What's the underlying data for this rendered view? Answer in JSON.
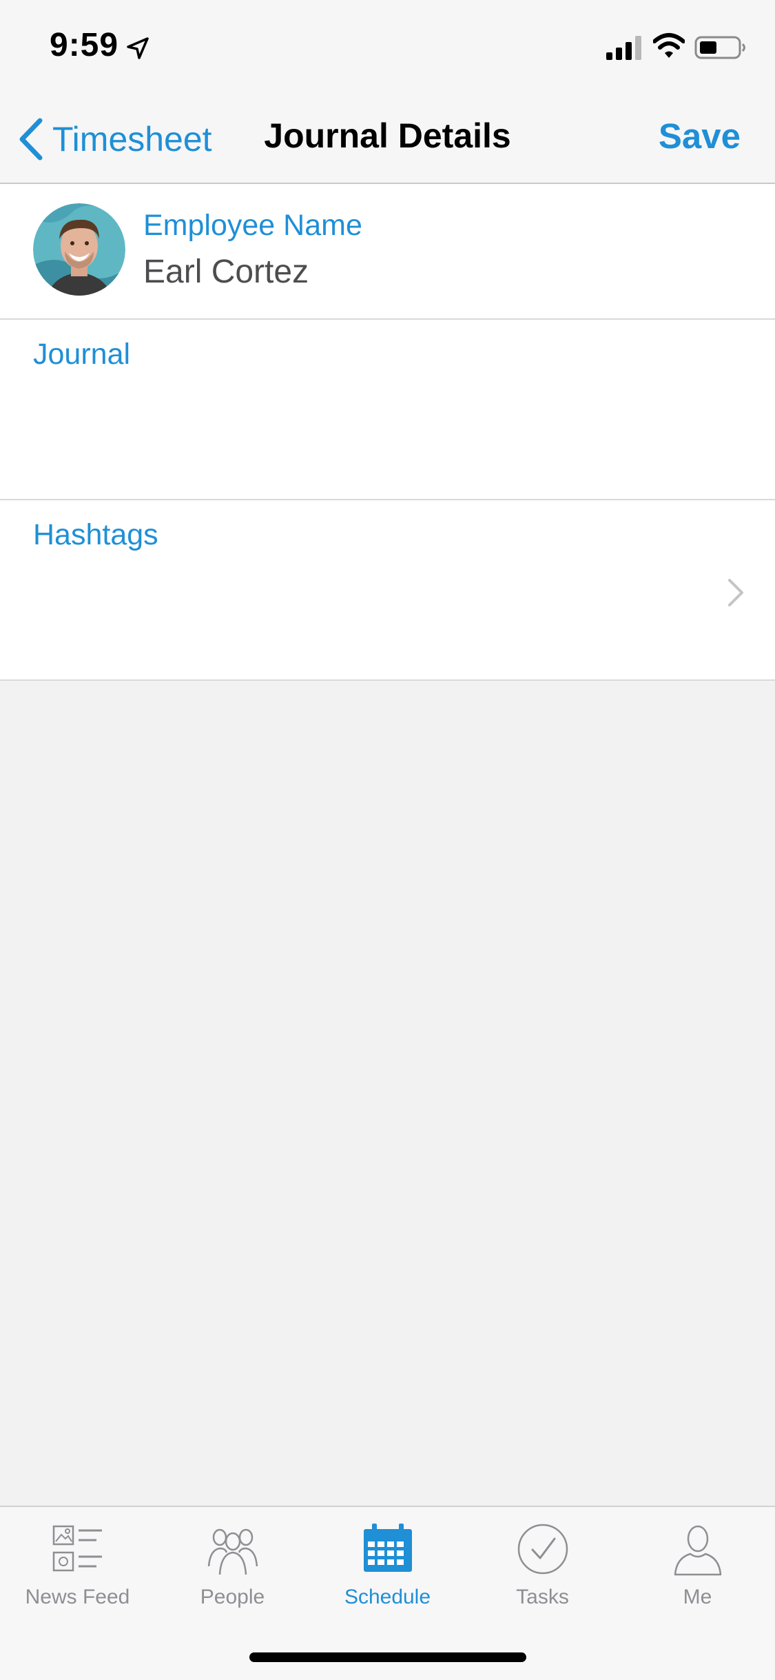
{
  "status_bar": {
    "time": "9:59"
  },
  "nav": {
    "back_label": "Timesheet",
    "title": "Journal Details",
    "save_label": "Save"
  },
  "employee": {
    "label": "Employee Name",
    "value": "Earl Cortez"
  },
  "journal": {
    "label": "Journal",
    "value": ""
  },
  "hashtags": {
    "label": "Hashtags",
    "value": ""
  },
  "tabs": [
    {
      "label": "News Feed",
      "icon": "news-feed-icon"
    },
    {
      "label": "People",
      "icon": "people-icon"
    },
    {
      "label": "Schedule",
      "icon": "calendar-icon",
      "active": true
    },
    {
      "label": "Tasks",
      "icon": "tasks-check-icon"
    },
    {
      "label": "Me",
      "icon": "person-icon"
    }
  ],
  "colors": {
    "accent": "#1f8fd6",
    "inactive_tab": "#8e8e93",
    "background": "#f2f2f3"
  }
}
